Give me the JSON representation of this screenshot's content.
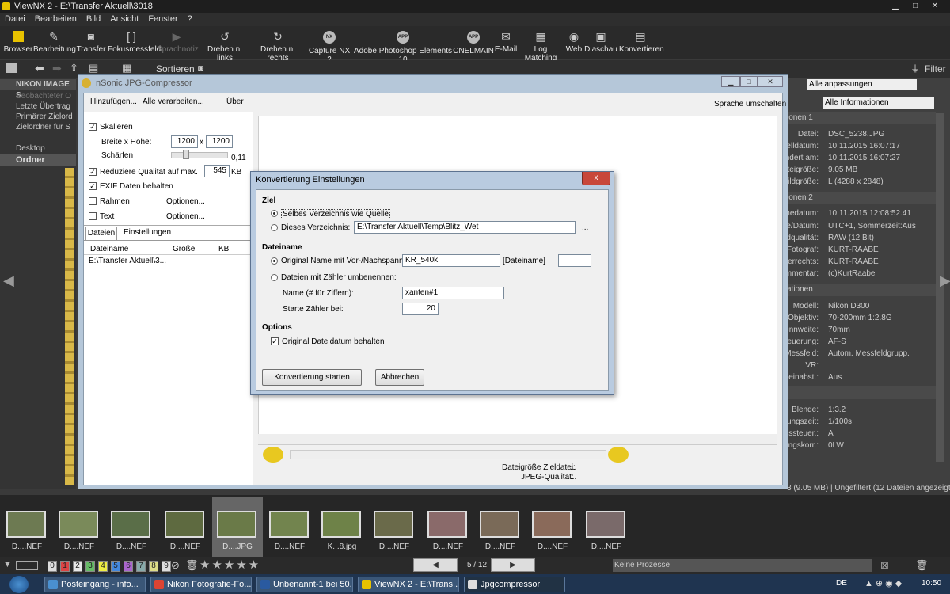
{
  "window": {
    "title": "ViewNX 2 - E:\\Transfer Aktuell\\3018"
  },
  "menu": [
    "Datei",
    "Bearbeiten",
    "Bild",
    "Ansicht",
    "Fenster",
    "?"
  ],
  "toolbar": [
    {
      "label": "Browser",
      "icon": "browser-icon"
    },
    {
      "label": "Bearbeitung",
      "icon": "edit-icon"
    },
    {
      "label": "Transfer",
      "icon": "camera-icon"
    },
    {
      "label": "Fokusmessfeld",
      "icon": "focus-icon"
    },
    {
      "label": "Sprachnotiz",
      "icon": "voice-memo-icon"
    },
    {
      "label": "Drehen n. links",
      "icon": "rotate-left-icon"
    },
    {
      "label": "Drehen n. rechts",
      "icon": "rotate-right-icon"
    },
    {
      "label": "Capture NX 2",
      "icon": "nx-icon"
    },
    {
      "label": "Adobe Photoshop Elements 10",
      "icon": "app-icon"
    },
    {
      "label": "CNELMAIN",
      "icon": "app-icon"
    },
    {
      "label": "E-Mail",
      "icon": "mail-icon"
    },
    {
      "label": "Log Matching",
      "icon": "log-icon"
    },
    {
      "label": "Web",
      "icon": "web-icon"
    },
    {
      "label": "Diaschau",
      "icon": "slideshow-icon"
    },
    {
      "label": "Konvertieren",
      "icon": "convert-icon"
    }
  ],
  "toolbar2": {
    "sort_label": "Sortieren",
    "filter_label": "Filter"
  },
  "left": {
    "header": "NIKON IMAGE S",
    "items": [
      "Beobachteter O",
      "Letzte Übertrag",
      "Primärer Zielord",
      "Zielordner für S",
      "Desktop"
    ],
    "folders_label": "Ordner"
  },
  "right": {
    "dropdown1": "Alle anpassungen",
    "dropdown2": "Alle Informationen",
    "sections": [
      "ionen 1",
      "ionen 2",
      "ationen"
    ],
    "info1": [
      [
        "Datei:",
        "DSC_5238.JPG"
      ],
      [
        "rstelldatum:",
        "10.11.2015 16:07:17"
      ],
      [
        "ändert am:",
        "10.11.2015 16:07:27"
      ],
      [
        "Dateigröße:",
        "9.05 MB"
      ],
      [
        "Bildgröße:",
        "L (4288 x 2848)"
      ]
    ],
    "info2": [
      [
        "hmedatum:",
        "10.11.2015 12:08:52.41"
      ],
      [
        "one/Datum:",
        "UTC+1, Sommerzeit:Aus"
      ],
      [
        "Bildqualität:",
        "RAW (12 Bit)"
      ],
      [
        "Fotograf:",
        "KURT-RAABE"
      ],
      [
        "eberrechts:",
        "KURT-RAABE"
      ],
      [
        "kommentar:",
        "(c)KurtRaabe"
      ]
    ],
    "info3": [
      [
        "Modell:",
        "Nikon D300"
      ],
      [
        "Objektiv:",
        "70-200mm 1:2.8G"
      ],
      [
        "Brennweite:",
        "70mm"
      ],
      [
        "ssteuerung:",
        "AF-S"
      ],
      [
        "F-Messfeld:",
        "Autom. Messfeldgrupp."
      ],
      [
        "VR:",
        ""
      ],
      [
        "F-Feinabst.:",
        "Aus"
      ]
    ],
    "info4": [
      [
        "Blende:",
        "1:3.2"
      ],
      [
        "chtungszeit:",
        "1/100s"
      ],
      [
        "hungssteuer.:",
        "A"
      ],
      [
        "htungskorr.:",
        "0LW"
      ]
    ],
    "status": "3 (9.05 MB) | Ungefiltert (12 Dateien angezeigt)"
  },
  "jpg": {
    "title": "nSonic JPG-Compressor",
    "menu": [
      "Hinzufügen...",
      "Alle verarbeiten...",
      "Über"
    ],
    "lang_button": "Sprache umschalten",
    "scale_label": "Skalieren",
    "wh_label": "Breite x Höhe:",
    "width": "1200",
    "x": "x",
    "height": "1200",
    "sharpen_label": "Schärfen",
    "sharpen_value": "0,11",
    "reduce_label": "Reduziere Qualität auf max.",
    "reduce_value": "545",
    "kb": "KB",
    "exif_label": "EXIF Daten behalten",
    "frame_label": "Rahmen",
    "text_label": "Text",
    "options_label": "Optionen...",
    "tabs": [
      "Dateien",
      "Einstellungen"
    ],
    "cols": [
      "Dateiname",
      "Größe",
      "KB"
    ],
    "row": "E:\\Transfer Aktuell\\3...",
    "target_size_label": "Dateigröße Zieldatei:",
    "jpeg_quality_label": "JPEG-Qualität:",
    "ellipsis": "..."
  },
  "dialog": {
    "title": "Konvertierung Einstellungen",
    "close": "x",
    "ziel": "Ziel",
    "same_dir": "Selbes Verzeichnis wie Quelle",
    "this_dir": "Dieses Verzeichnis:",
    "dir_value": "E:\\Transfer Aktuell\\Temp\\Blitz_Wet",
    "browse": "...",
    "dateiname": "Dateiname",
    "orig_name": "Original Name mit Vor-/Nachspann:",
    "prefix": "KR_540k",
    "dateiname_token": "[Dateiname]",
    "suffix": "",
    "counter": "Dateien mit Zähler umbenennen:",
    "name_label": "Name (# für Ziffern):",
    "name_value": "xanten#1",
    "start_label": "Starte Zähler bei:",
    "start_value": "20",
    "options": "Options",
    "keep_date": "Original Dateidatum behalten",
    "start_btn": "Konvertierung starten",
    "cancel_btn": "Abbrechen"
  },
  "filmstrip": [
    {
      "label": "D....NEF",
      "color": "#6d7a52"
    },
    {
      "label": "D....NEF",
      "color": "#7a8a5a"
    },
    {
      "label": "D....NEF",
      "color": "#5a6e48"
    },
    {
      "label": "D....NEF",
      "color": "#5e6a40"
    },
    {
      "label": "D....JPG",
      "color": "#6a7a48"
    },
    {
      "label": "D....NEF",
      "color": "#72844e"
    },
    {
      "label": "K...8.jpg",
      "color": "#6e8248"
    },
    {
      "label": "D....NEF",
      "color": "#6a6a4a"
    },
    {
      "label": "D....NEF",
      "color": "#8a6a6a"
    },
    {
      "label": "D....NEF",
      "color": "#7a6a58"
    },
    {
      "label": "D....NEF",
      "color": "#8a6a5a"
    },
    {
      "label": "D....NEF",
      "color": "#7a6a6a"
    }
  ],
  "bottombar": {
    "ratings": [
      "0",
      "1",
      "2",
      "3",
      "4",
      "5",
      "6",
      "7",
      "8",
      "9"
    ],
    "rating_colors": [
      "#dddddd",
      "#d44",
      "#e8e8e8",
      "#6b6",
      "#ee4",
      "#48d",
      "#a6c",
      "#8aa",
      "#dd8",
      "#ddd"
    ],
    "pager": "5 / 12",
    "process": "Keine Prozesse"
  },
  "taskbar": {
    "items": [
      {
        "label": "Posteingang - info...",
        "color": "#4a90d0"
      },
      {
        "label": "Nikon Fotografie-Fo...",
        "color": "#d43"
      },
      {
        "label": "Unbenannt-1 bei 50...",
        "color": "#2a5aa0"
      },
      {
        "label": "ViewNX 2 - E:\\Trans...",
        "color": "#e8c200"
      },
      {
        "label": "Jpgcompressor",
        "color": "#ddd"
      }
    ],
    "lang": "DE",
    "time": "10:50"
  }
}
